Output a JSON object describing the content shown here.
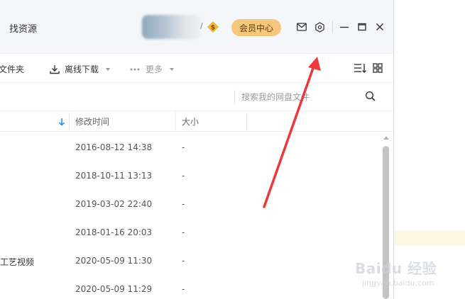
{
  "titlebar": {
    "find_resources_tab": "找资源",
    "vip_level_mark": "/",
    "member_center_label": "会员中心"
  },
  "toolbar": {
    "new_folder_label": "文件夹",
    "offline_download_label": "离线下载",
    "more_label": "更多"
  },
  "search": {
    "placeholder": "搜索我的网盘文件"
  },
  "table": {
    "columns": {
      "modified": "修改时间",
      "size": "大小"
    },
    "rows": [
      {
        "name": "",
        "modified": "2016-08-12 14:38",
        "size": "-"
      },
      {
        "name": "",
        "modified": "2018-10-11 13:13",
        "size": "-"
      },
      {
        "name": "",
        "modified": "2019-03-02 22:40",
        "size": "-"
      },
      {
        "name": "",
        "modified": "2018-01-16 20:03",
        "size": "-"
      },
      {
        "name": "工艺视频",
        "modified": "2020-05-09 11:30",
        "size": "-"
      },
      {
        "name": "",
        "modified": "2020-05-09 11:29",
        "size": "-"
      }
    ]
  },
  "watermark": {
    "brand": "Baidu 经验",
    "url": "jingyan.baidu.com"
  },
  "colors": {
    "accent_blue": "#1a8ceb",
    "member_gold": "#f4c77c",
    "annotation_red": "#ea3a3a"
  }
}
